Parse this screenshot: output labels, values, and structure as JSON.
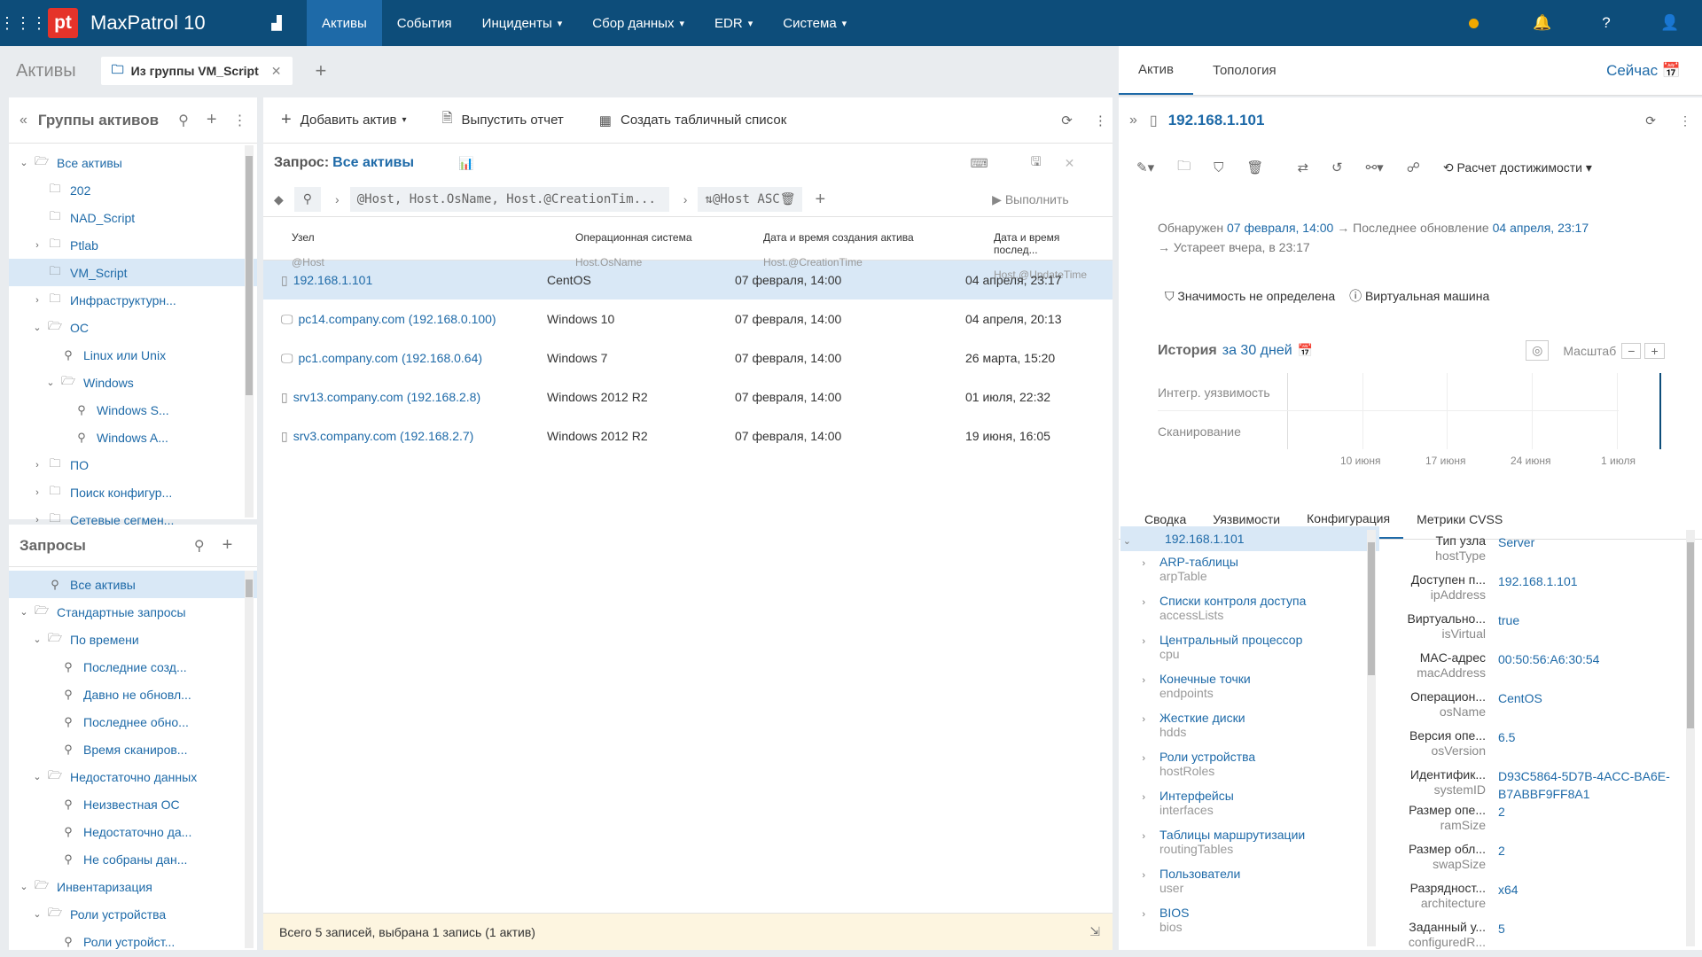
{
  "app": {
    "title": "MaxPatrol 10",
    "logo": "pt"
  },
  "nav": [
    {
      "label": "Активы",
      "active": true
    },
    {
      "label": "События"
    },
    {
      "label": "Инциденты"
    },
    {
      "label": "Сбор данных"
    },
    {
      "label": "EDR"
    },
    {
      "label": "Система"
    }
  ],
  "header": {
    "section": "Активы",
    "tab": "Из группы VM_Script",
    "right_tabs": [
      "Актив",
      "Топология"
    ],
    "now": "Сейчас"
  },
  "groups": {
    "title": "Группы активов",
    "items": [
      {
        "label": "Все активы",
        "lvl": 0,
        "open": true,
        "ic": "folder-open"
      },
      {
        "label": "202",
        "lvl": 1,
        "ic": "folder"
      },
      {
        "label": "NAD_Script",
        "lvl": 1,
        "ic": "folder"
      },
      {
        "label": "Ptlab",
        "lvl": 1,
        "ic": "folder",
        "ch": true
      },
      {
        "label": "VM_Script",
        "lvl": 1,
        "ic": "folder",
        "sel": true
      },
      {
        "label": "Инфраструктурн...",
        "lvl": 1,
        "ic": "folder",
        "ch": true
      },
      {
        "label": "ОС",
        "lvl": 1,
        "ic": "folder-open",
        "open": true
      },
      {
        "label": "Linux или Unix",
        "lvl": 2,
        "ic": "search"
      },
      {
        "label": "Windows",
        "lvl": 2,
        "ic": "folder-open",
        "open": true
      },
      {
        "label": "Windows S...",
        "lvl": 3,
        "ic": "search"
      },
      {
        "label": "Windows A...",
        "lvl": 3,
        "ic": "search"
      },
      {
        "label": "ПО",
        "lvl": 1,
        "ic": "folder",
        "ch": true
      },
      {
        "label": "Поиск конфигур...",
        "lvl": 1,
        "ic": "folder",
        "ch": true
      },
      {
        "label": "Сетевые сегмен...",
        "lvl": 1,
        "ic": "folder",
        "ch": true
      }
    ]
  },
  "queries": {
    "title": "Запросы",
    "items": [
      {
        "label": "Все активы",
        "lvl": 1,
        "ic": "search",
        "sel": true
      },
      {
        "label": "Стандартные запросы",
        "lvl": 0,
        "ic": "folder-open",
        "open": true
      },
      {
        "label": "По времени",
        "lvl": 1,
        "ic": "folder-open",
        "open": true
      },
      {
        "label": "Последние созд...",
        "lvl": 2,
        "ic": "search"
      },
      {
        "label": "Давно не обновл...",
        "lvl": 2,
        "ic": "search"
      },
      {
        "label": "Последнее обно...",
        "lvl": 2,
        "ic": "search"
      },
      {
        "label": "Время сканиров...",
        "lvl": 2,
        "ic": "search"
      },
      {
        "label": "Недостаточно данных",
        "lvl": 1,
        "ic": "folder-open",
        "open": true
      },
      {
        "label": "Неизвестная ОС",
        "lvl": 2,
        "ic": "search"
      },
      {
        "label": "Недостаточно да...",
        "lvl": 2,
        "ic": "search"
      },
      {
        "label": "Не собраны дан...",
        "lvl": 2,
        "ic": "search"
      },
      {
        "label": "Инвентаризация",
        "lvl": 0,
        "ic": "folder-open",
        "open": true
      },
      {
        "label": "Роли устройства",
        "lvl": 1,
        "ic": "folder-open",
        "open": true
      },
      {
        "label": "Роли устройст...",
        "lvl": 2,
        "ic": "search"
      }
    ]
  },
  "toolbar": {
    "add": "Добавить актив",
    "report": "Выпустить отчет",
    "table": "Создать табличный список"
  },
  "query": {
    "label": "Запрос:",
    "value": "Все активы",
    "select": "@Host, Host.OsName, Host.@CreationTim...",
    "sort": "@Host ASC",
    "run": "Выполнить"
  },
  "columns": [
    {
      "a": "Узел",
      "b": "@Host"
    },
    {
      "a": "Операционная система",
      "b": "Host.OsName"
    },
    {
      "a": "Дата и время создания актива",
      "b": "Host.@CreationTime"
    },
    {
      "a": "Дата и время послед...",
      "b": "Host.@UpdateTime"
    }
  ],
  "rows": [
    {
      "host": "192.168.1.101",
      "os": "CentOS",
      "created": "07 февраля, 14:00",
      "updated": "04 апреля, 23:17",
      "sel": true,
      "ic": "server"
    },
    {
      "host": "pc14.company.com (192.168.0.100)",
      "os": "Windows 10",
      "created": "07 февраля, 14:00",
      "updated": "04 апреля, 20:13",
      "ic": "pc"
    },
    {
      "host": "pc1.company.com (192.168.0.64)",
      "os": "Windows 7",
      "created": "07 февраля, 14:00",
      "updated": "26 марта, 15:20",
      "ic": "pc"
    },
    {
      "host": "srv13.company.com (192.168.2.8)",
      "os": "Windows 2012 R2",
      "created": "07 февраля, 14:00",
      "updated": "01 июля, 22:32",
      "ic": "server"
    },
    {
      "host": "srv3.company.com (192.168.2.7)",
      "os": "Windows 2012 R2",
      "created": "07 февраля, 14:00",
      "updated": "19 июня, 16:05",
      "ic": "server"
    }
  ],
  "footer": "Всего 5 записей, выбрана 1 запись  (1 актив)",
  "asset": {
    "title": "192.168.1.101",
    "reach": "Расчет достижимости",
    "found_lbl": "Обнаружен",
    "found": "07 февраля, 14:00",
    "upd_lbl": "Последнее обновление",
    "upd": "04 апреля, 23:17",
    "stale": "Устареет вчера, в 23:17",
    "importance": "Значимость не определена",
    "vm": "Виртуальная машина",
    "hist_lbl": "История",
    "hist": "за 30 дней",
    "scale": "Масштаб",
    "rows": [
      "Интегр. уязвимость",
      "Сканирование"
    ],
    "ticks": [
      "10 июня",
      "17 июня",
      "24 июня",
      "1 июля"
    ],
    "tabs": [
      "Сводка",
      "Уязвимости",
      "Конфигурация",
      "Метрики CVSS"
    ]
  },
  "cfg": [
    {
      "l": "192.168.1.101",
      "s": "",
      "root": true
    },
    {
      "l": "ARP-таблицы",
      "s": "arpTable"
    },
    {
      "l": "Списки контроля доступа",
      "s": "accessLists"
    },
    {
      "l": "Центральный процессор",
      "s": "cpu"
    },
    {
      "l": "Конечные точки",
      "s": "endpoints"
    },
    {
      "l": "Жесткие диски",
      "s": "hdds"
    },
    {
      "l": "Роли устройства",
      "s": "hostRoles"
    },
    {
      "l": "Интерфейсы",
      "s": "interfaces"
    },
    {
      "l": "Таблицы маршрутизации",
      "s": "routingTables"
    },
    {
      "l": "Пользователи",
      "s": "user"
    },
    {
      "l": "BIOS",
      "s": "bios"
    }
  ],
  "props": [
    {
      "k": "Тип узла",
      "s": "hostType",
      "v": "Server"
    },
    {
      "k": "Доступен п...",
      "s": "ipAddress",
      "v": "192.168.1.101"
    },
    {
      "k": "Виртуально...",
      "s": "isVirtual",
      "v": "true"
    },
    {
      "k": "MAC-адрес",
      "s": "macAddress",
      "v": "00:50:56:A6:30:54"
    },
    {
      "k": "Операцион...",
      "s": "osName",
      "v": "CentOS"
    },
    {
      "k": "Версия опе...",
      "s": "osVersion",
      "v": "6.5"
    },
    {
      "k": "Идентифик...",
      "s": "systemID",
      "v": "D93C5864-5D7B-4ACC-BA6E-B7ABBF9FF8A1"
    },
    {
      "k": "Размер опе...",
      "s": "ramSize",
      "v": "2"
    },
    {
      "k": "Размер обл...",
      "s": "swapSize",
      "v": "2"
    },
    {
      "k": "Разрядност...",
      "s": "architecture",
      "v": "x64"
    },
    {
      "k": "Заданный у...",
      "s": "configuredR...",
      "v": "5"
    }
  ]
}
